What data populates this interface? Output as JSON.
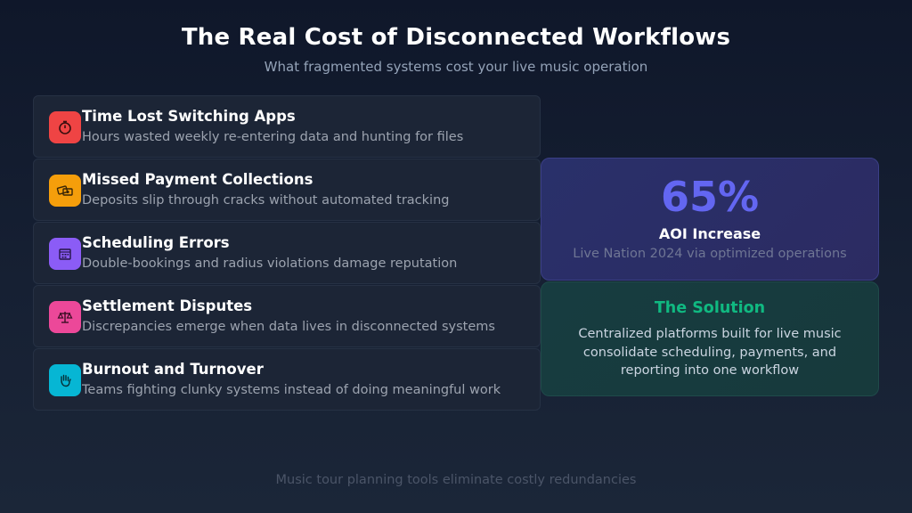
{
  "header": {
    "title": "The Real Cost of Disconnected Workflows",
    "subtitle": "What fragmented systems cost your live music operation"
  },
  "cards": [
    {
      "icon": "stopwatch-icon",
      "color": "#ef4444",
      "title": "Time Lost Switching Apps",
      "description": "Hours wasted weekly re-entering data and hunting for files"
    },
    {
      "icon": "money-icon",
      "color": "#f59e0b",
      "title": "Missed Payment Collections",
      "description": "Deposits slip through cracks without automated tracking"
    },
    {
      "icon": "calendar-icon",
      "color": "#8b5cf6",
      "title": "Scheduling Errors",
      "description": "Double-bookings and radius violations damage reputation"
    },
    {
      "icon": "scales-icon",
      "color": "#ec4899",
      "title": "Settlement Disputes",
      "description": "Discrepancies emerge when data lives in disconnected systems"
    },
    {
      "icon": "hand-icon",
      "color": "#06b6d4",
      "title": "Burnout and Turnover",
      "description": "Teams fighting clunky systems instead of doing meaningful work"
    }
  ],
  "stat": {
    "value": "65%",
    "label": "AOI Increase",
    "source": "Live Nation 2024 via optimized operations"
  },
  "solution": {
    "title": "The Solution",
    "text": "Centralized platforms built for live music consolidate scheduling, payments, and reporting into one workflow"
  },
  "footer": {
    "text": "Music tour planning tools eliminate costly redundancies"
  },
  "colors": {
    "stat_accent": "#6366f1",
    "solution_accent": "#10b981"
  }
}
